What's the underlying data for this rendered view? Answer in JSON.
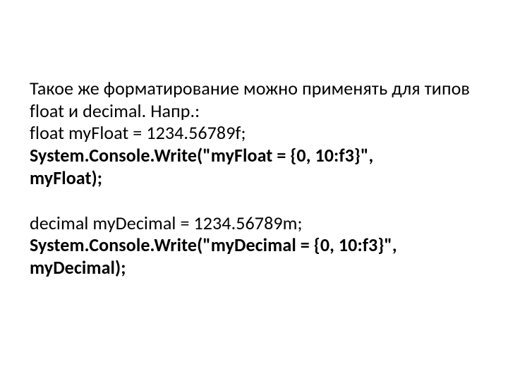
{
  "lines": {
    "l1": "Такое же форматирование можно применять для типов float и decimal. Напр.:",
    "l2": "float myFloat = 1234.56789f;",
    "l3": "System.Console.Write(\"myFloat =   {0, 10:f3}\",",
    "l4": "myFloat);",
    "l5": "decimal myDecimal = 1234.56789m;",
    "l6": "System.Console.Write(\"myDecimal = {0, 10:f3}\", myDecimal);"
  }
}
